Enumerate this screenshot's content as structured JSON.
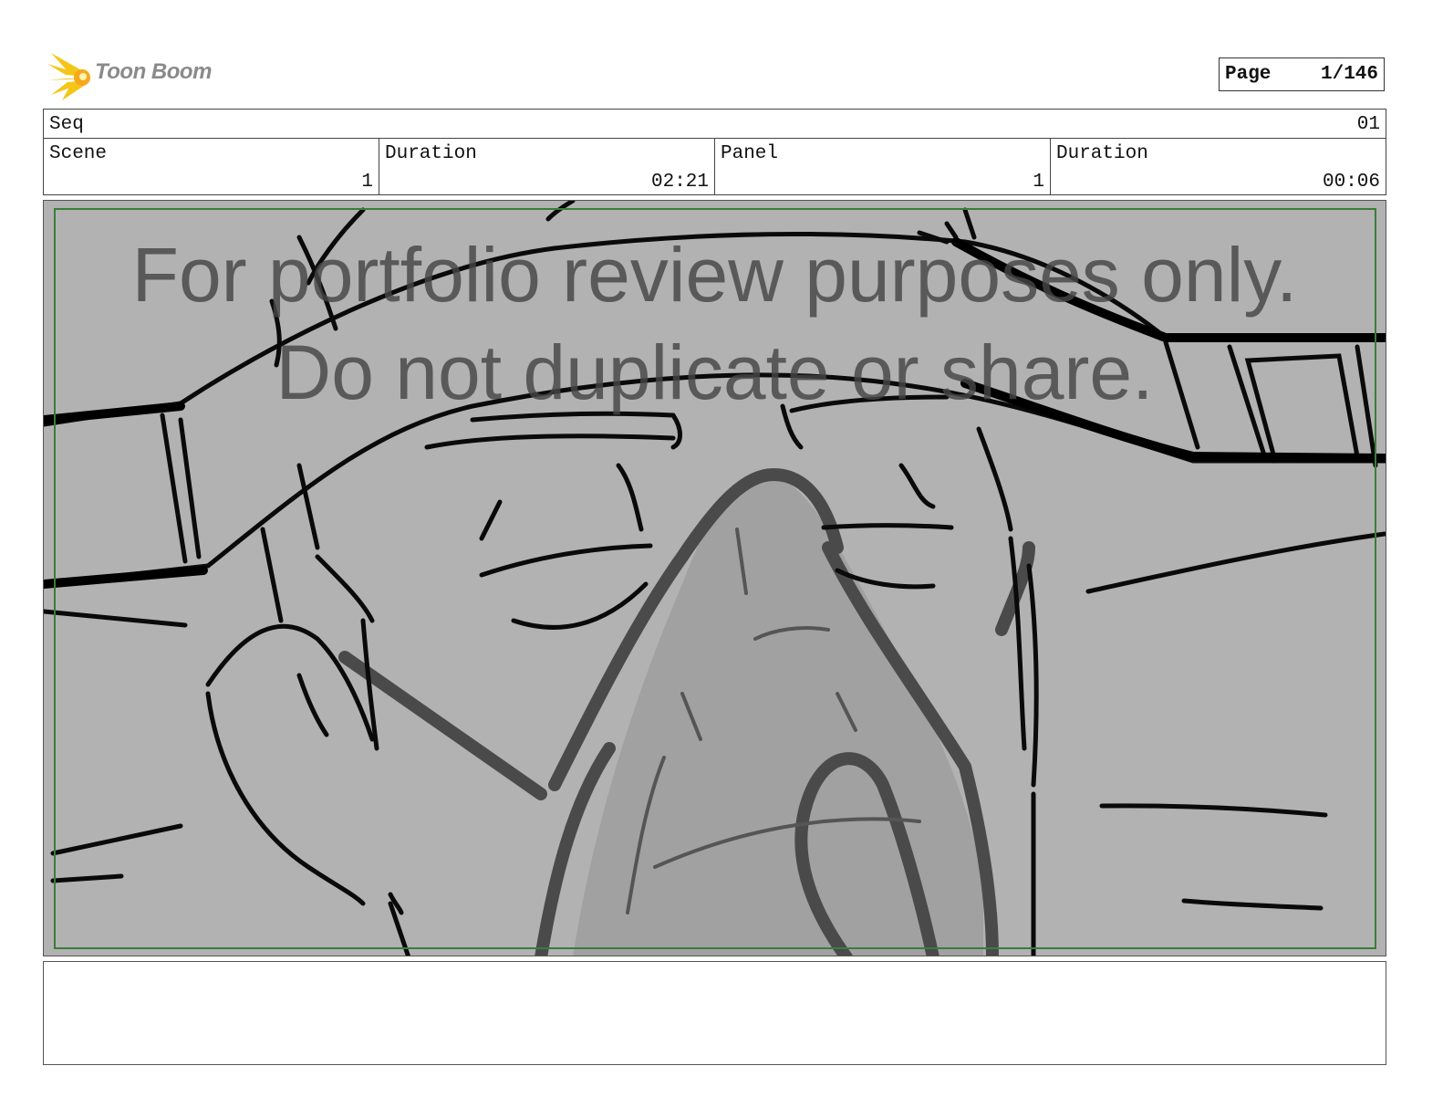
{
  "header": {
    "logo_text": "Toon Boom",
    "logo_accent": "#f5c518",
    "page_label": "Page",
    "page_value": "1/146"
  },
  "info": {
    "seq_label": "Seq",
    "seq_value": "01",
    "scene_label": "Scene",
    "scene_value": "1",
    "scene_duration_label": "Duration",
    "scene_duration_value": "02:21",
    "panel_label": "Panel",
    "panel_value": "1",
    "panel_duration_label": "Duration",
    "panel_duration_value": "00:06"
  },
  "panel": {
    "watermark_line1": "For portfolio review purposes only.",
    "watermark_line2": "Do not duplicate or share.",
    "background_color": "#b2b2b2",
    "safe_frame_color": "#3a7d3a"
  },
  "notes": {
    "text": ""
  }
}
